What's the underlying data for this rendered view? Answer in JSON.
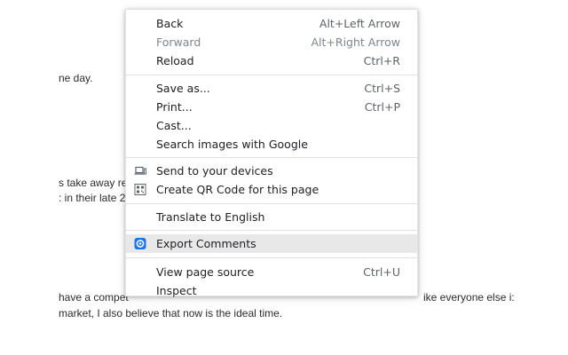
{
  "background": {
    "line1": "ne day.",
    "line2": "s take away re",
    "line3": ": in their late 2",
    "line4": "have a compet",
    "line4_tail": "ike everyone else i:",
    "line5": " market, I also believe that now is the ideal time."
  },
  "menu": {
    "items": [
      {
        "label": "Back",
        "shortcut": "Alt+Left Arrow"
      },
      {
        "label": "Forward",
        "shortcut": "Alt+Right Arrow",
        "disabled": true
      },
      {
        "label": "Reload",
        "shortcut": "Ctrl+R"
      },
      {
        "label": "Save as...",
        "shortcut": "Ctrl+S"
      },
      {
        "label": "Print...",
        "shortcut": "Ctrl+P"
      },
      {
        "label": "Cast..."
      },
      {
        "label": "Search images with Google"
      },
      {
        "label": "Send to your devices",
        "icon": "laptop-icon"
      },
      {
        "label": "Create QR Code for this page",
        "icon": "qr-code-icon"
      },
      {
        "label": "Translate to English"
      },
      {
        "label": "Export Comments",
        "icon": "extension-icon",
        "highlighted": true
      },
      {
        "label": "View page source",
        "shortcut": "Ctrl+U"
      },
      {
        "label": "Inspect"
      }
    ]
  },
  "colors": {
    "highlight": "#e8e8e8",
    "separator": "#e1e1e1",
    "text": "#202124",
    "disabled_text": "#80868b",
    "extension_icon": "#1a73e8"
  }
}
